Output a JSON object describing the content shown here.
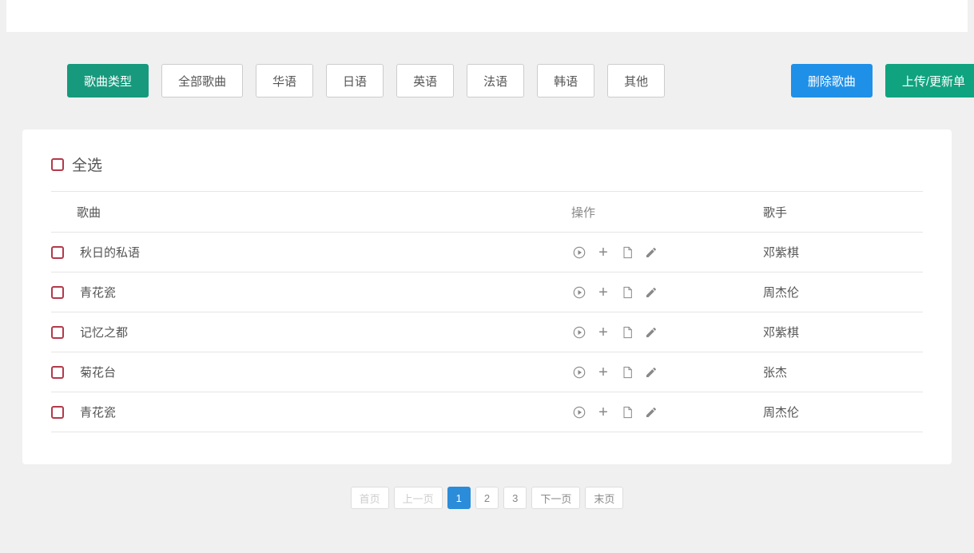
{
  "toolbar": {
    "type_label": "歌曲类型",
    "filters": [
      "全部歌曲",
      "华语",
      "日语",
      "英语",
      "法语",
      "韩语",
      "其他"
    ],
    "delete_label": "删除歌曲",
    "upload_label": "上传/更新单"
  },
  "select_all_label": "全选",
  "columns": {
    "song": "歌曲",
    "ops": "操作",
    "artist": "歌手"
  },
  "songs": [
    {
      "title": "秋日的私语",
      "artist": "邓紫棋"
    },
    {
      "title": "青花瓷",
      "artist": "周杰伦"
    },
    {
      "title": "记忆之都",
      "artist": "邓紫棋"
    },
    {
      "title": "菊花台",
      "artist": "张杰"
    },
    {
      "title": "青花瓷",
      "artist": "周杰伦"
    }
  ],
  "pagination": {
    "first": "首页",
    "prev": "上一页",
    "pages": [
      "1",
      "2",
      "3"
    ],
    "active": "1",
    "next": "下一页",
    "last": "末页"
  }
}
